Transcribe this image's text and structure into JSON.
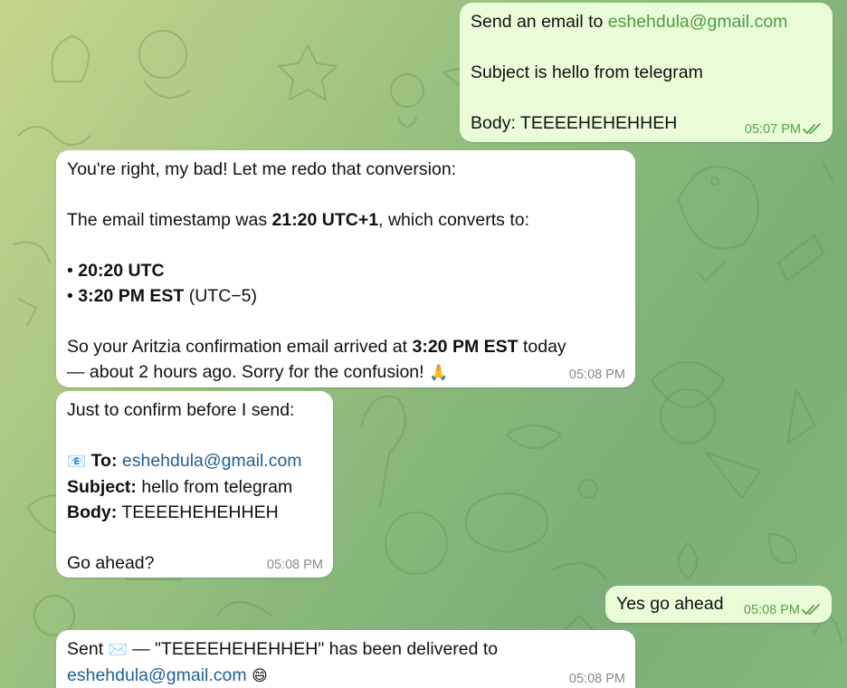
{
  "messages": [
    {
      "id": "m1",
      "direction": "outgoing",
      "lines": {
        "l1_prefix": "Send an email to ",
        "l1_email": "eshehdula@gmail.com",
        "l2": "Subject is hello from telegram",
        "l3": "Body: TEEEEHEHEHHEH"
      },
      "time": "05:07 PM",
      "status_icon": "double-check-icon"
    },
    {
      "id": "m2",
      "direction": "incoming",
      "lines": {
        "l1": "You're right, my bad! Let me redo that conversion:",
        "l2_a": "The email timestamp was ",
        "l2_b": "21:20 UTC+1",
        "l2_c": ", which converts to:",
        "bullet1_dot": "• ",
        "bullet1": "20:20 UTC",
        "bullet2_dot": "• ",
        "bullet2_bold": "3:20 PM EST",
        "bullet2_rest": " (UTC−5)",
        "l5_a": "So your Aritzia confirmation email arrived at ",
        "l5_b": "3:20 PM EST",
        "l5_c": " today",
        "l6": "— about 2 hours ago. Sorry for the confusion! ",
        "l6_emoji": "🙏"
      },
      "time": "05:08 PM"
    },
    {
      "id": "m3",
      "direction": "incoming",
      "lines": {
        "l1": "Just to confirm before I send:",
        "to_emoji": "📧",
        "to_label": "To:",
        "to_value": "eshehdula@gmail.com",
        "subject_label": "Subject:",
        "subject_value": " hello from telegram",
        "body_label": "Body:",
        "body_value": " TEEEEHEHEHHEH",
        "l5": "Go ahead?"
      },
      "time": "05:08 PM"
    },
    {
      "id": "m4",
      "direction": "outgoing",
      "lines": {
        "l1": "Yes go ahead"
      },
      "time": "05:08 PM",
      "status_icon": "double-check-icon"
    },
    {
      "id": "m5",
      "direction": "incoming",
      "lines": {
        "l1_a": "Sent ",
        "l1_emoji": "✉️",
        "l1_b": " — \"TEEEEHEHEHHEH\" has been delivered to",
        "l2_email": "eshehdula@gmail.com",
        "l2_emoji": "😄"
      },
      "time": "05:08 PM"
    }
  ],
  "colors": {
    "incoming_bubble": "#ffffff",
    "outgoing_bubble": "#e9fdd8",
    "outgoing_accent": "#4e9a43",
    "incoming_link": "#1f5f96",
    "wallpaper": "#8cba7c"
  }
}
